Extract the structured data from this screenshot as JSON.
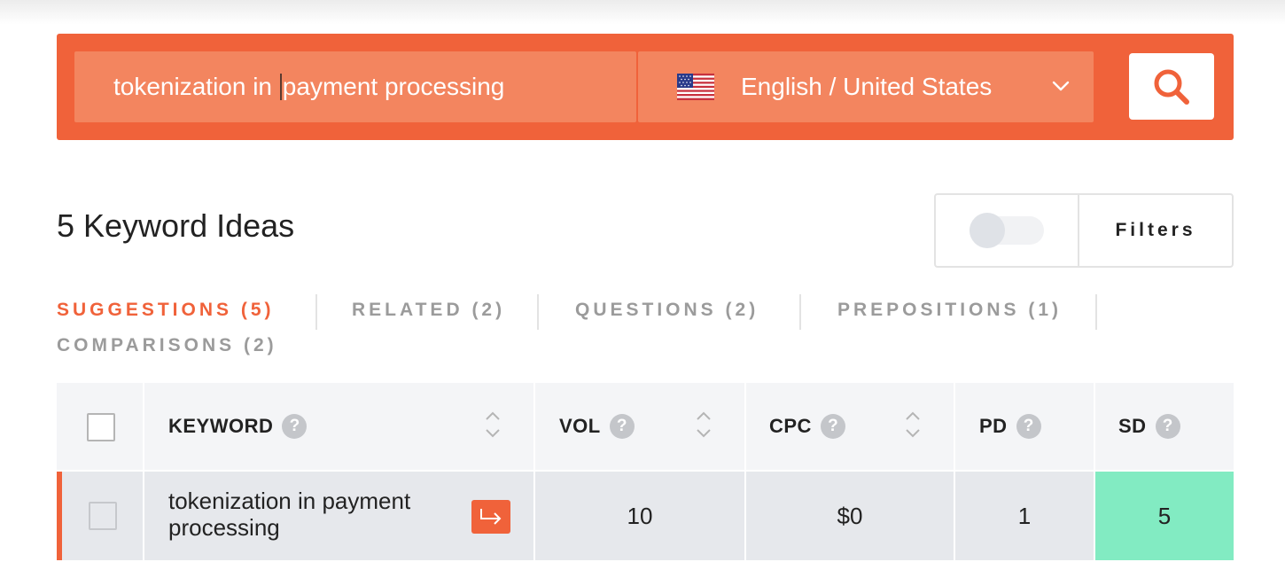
{
  "search": {
    "keyword_before_caret": "tokenization in ",
    "keyword_after_caret": "payment processing",
    "location": "English / United States",
    "flag_icon": "us-flag-icon",
    "search_icon": "search-icon",
    "accent_color": "#f0623a"
  },
  "results": {
    "count_title": "5 Keyword Ideas",
    "filters_label": "Filters"
  },
  "tabs": [
    {
      "label": "SUGGESTIONS (5)",
      "active": true
    },
    {
      "label": "RELATED (2)",
      "active": false
    },
    {
      "label": "QUESTIONS (2)",
      "active": false
    },
    {
      "label": "PREPOSITIONS (1)",
      "active": false
    },
    {
      "label": "COMPARISONS (2)",
      "active": false
    }
  ],
  "table": {
    "columns": {
      "keyword": "KEYWORD",
      "vol": "VOL",
      "cpc": "CPC",
      "pd": "PD",
      "sd": "SD",
      "help": "?"
    },
    "rows": [
      {
        "keyword": "tokenization in payment processing",
        "vol": "10",
        "cpc": "$0",
        "pd": "1",
        "sd": "5",
        "sd_color": "#82ebc2"
      }
    ]
  }
}
